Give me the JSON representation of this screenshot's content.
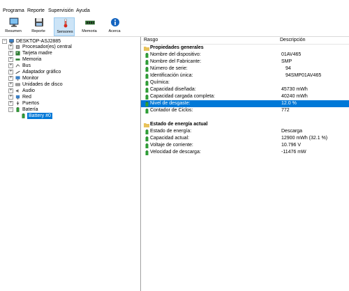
{
  "menu": [
    "Programa",
    "Reporte",
    "Supervisión",
    "Ayuda"
  ],
  "toolbar": {
    "buttons": [
      {
        "label": "Resumen",
        "icon": "monitor-icon"
      },
      {
        "label": "Reporte",
        "icon": "floppy-icon"
      },
      {
        "label": "Sensores",
        "icon": "thermometer-icon"
      },
      {
        "label": "Memoria",
        "icon": "memory-icon"
      },
      {
        "label": "Acerca",
        "icon": "info-icon"
      }
    ]
  },
  "tree": {
    "root": "DESKTOP-ASJ2885",
    "items": [
      "Procesador(es) central",
      "Tarjeta madre",
      "Memoria",
      "Bus",
      "Adaptador gráfico",
      "Monitor",
      "Unidades de disco",
      "Audio",
      "Red",
      "Puertos",
      "Batería"
    ],
    "selected_child": "Battery #0"
  },
  "list": {
    "col_field": "Rasgo",
    "col_value": "Descripción",
    "section1": "Propiedades generales",
    "section2": "Estado de energía actual",
    "general": [
      {
        "name": "Nombre del dispositivo:",
        "value": "01AV465"
      },
      {
        "name": "Nombre del Fabricante:",
        "value": "SMP"
      },
      {
        "name": "Número de serie:",
        "value": "94"
      },
      {
        "name": "Identificación única:",
        "value": "94SMP01AV465"
      },
      {
        "name": "Química:",
        "value": ""
      },
      {
        "name": "Capacidad diseñada:",
        "value": "45730 mWh"
      },
      {
        "name": "Capacidad cargada completa:",
        "value": "40240 mWh"
      },
      {
        "name": "Nivel de desgaste:",
        "value": "12.0 %"
      },
      {
        "name": "Contador de Ciclos:",
        "value": "772"
      }
    ],
    "power": [
      {
        "name": "Estado de energía:",
        "value": "Descarga"
      },
      {
        "name": "Capacidad actual:",
        "value": "12900 mWh (32.1 %)"
      },
      {
        "name": "Voltaje de corriente:",
        "value": "10.796 V"
      },
      {
        "name": "Velocidad de descarga:",
        "value": "-11476 mW"
      }
    ]
  }
}
